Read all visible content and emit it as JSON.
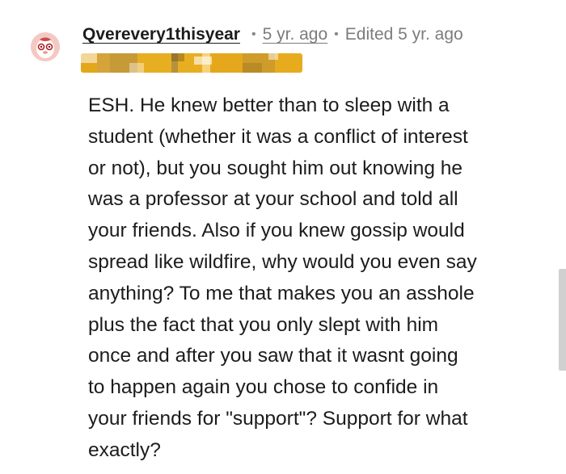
{
  "comment": {
    "username": "Qverevery1thisyear",
    "separator": "•",
    "timestamp": "5 yr. ago",
    "edited": "Edited 5 yr. ago",
    "body": "ESH. He knew better than to sleep with a\nstudent (whether it was a conflict of interest\nor not), but you sought him out knowing he\nwas a professor at your school and told all\nyour friends. Also if you knew gossip would\nspread like wildfire, why would you even say\nanything? To me that makes you an asshole\nplus the fact that you only slept with him\nonce and after you saw that it wasnt going\nto happen again you chose to confide in\nyour friends for \"support\"? Support for what\nexactly?",
    "avatar_icon": "user-avatar-icon",
    "flair_state": "pixelated"
  },
  "colors": {
    "text": "#1c1c1c",
    "meta": "#7c7c7c",
    "flair": "#e3a71a",
    "avatar_bg": "#f4c9c2",
    "scrollbar": "#d0d0d0"
  }
}
